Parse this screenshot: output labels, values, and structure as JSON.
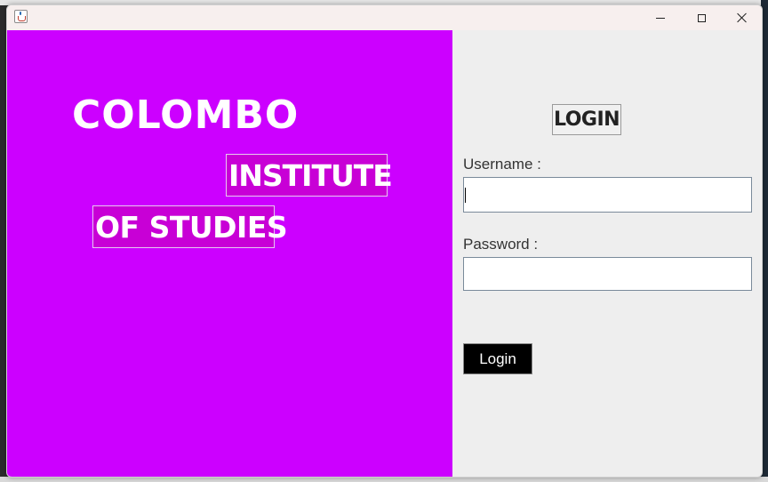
{
  "window": {
    "icon": "java-cup-icon",
    "controls": {
      "minimize": "minimize-icon",
      "maximize": "maximize-icon",
      "close": "close-icon"
    }
  },
  "brand": {
    "line1": "COLOMBO",
    "line2": "INSTITUTE",
    "line3": "OF STUDIES",
    "panel_color": "#cc00ff"
  },
  "login": {
    "title": "LOGIN",
    "username_label": "Username :",
    "username_value": "",
    "password_label": "Password :",
    "password_value": "",
    "button_label": "Login"
  }
}
